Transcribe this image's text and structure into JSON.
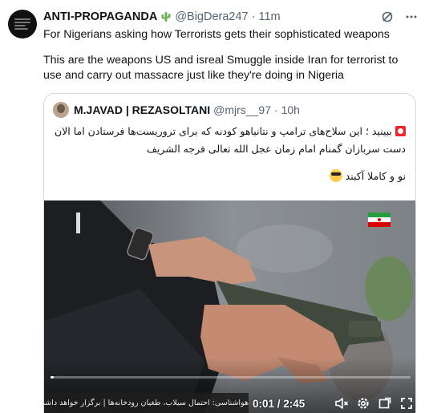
{
  "author": {
    "name": "ANTI-PROPAGANDA",
    "handle": "@BigDera247",
    "separator": "·",
    "time": "11m"
  },
  "tweet": {
    "line1": "For Nigerians asking how Terrorists gets their sophisticated weapons",
    "line2": "This are the weapons US and isreal Smuggle inside Iran for terrorist to use and carry out massacre just like they're doing in Nigeria"
  },
  "quote": {
    "name": "M.JAVAD | REZASOLTANI",
    "handle": "@mjrs__97",
    "separator": "·",
    "time": "10h",
    "text_line1": "ببینید ؛ این سلاح‌های ترامپ و نتانیاهو کودنه که برای تروریست‌ها فرستادن اما الان دست سربازان گمنام امام زمان عجل الله تعالی فرجه الشریف",
    "text_line2": "نو و کاملا آکبند"
  },
  "video": {
    "timecode": "0:01 / 2:45",
    "progress": 0.006,
    "ticker": "هواشناسی: احتمال سیلاب، طغیان رودخانه‌ها | برگزار خواهد داشت",
    "colors": {
      "ticker_bg": "#1e1e1e"
    }
  },
  "icons": {
    "author_avatar": "avatar-icon",
    "verified_emoji": "cactus-icon",
    "grok": "grok-icon",
    "more": "more-icon",
    "flag": "iran-flag-icon",
    "volume": "volume-icon",
    "settings": "settings-gear-icon",
    "fullscreen": "fullscreen-icon"
  }
}
